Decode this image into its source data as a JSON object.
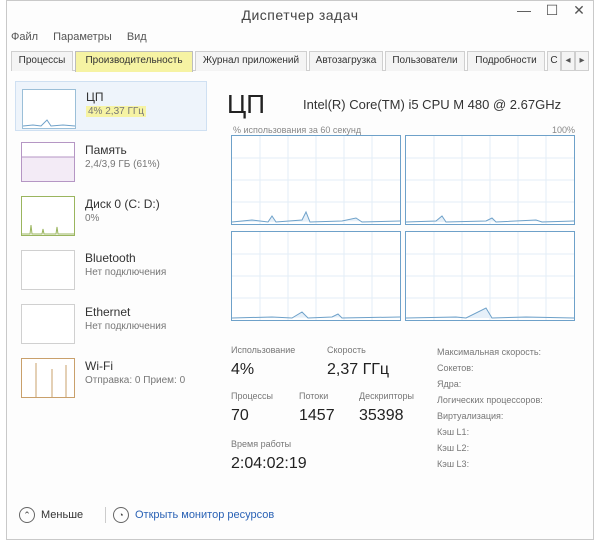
{
  "window": {
    "title": "Диспетчер задач",
    "min": "—",
    "max": "☐",
    "close": "✕"
  },
  "menu": [
    "Файл",
    "Параметры",
    "Вид"
  ],
  "tabs": [
    {
      "label": "Процессы",
      "active": false
    },
    {
      "label": "Производительность",
      "active": true
    },
    {
      "label": "Журнал приложений",
      "active": false
    },
    {
      "label": "Автозагрузка",
      "active": false
    },
    {
      "label": "Пользователи",
      "active": false
    },
    {
      "label": "Подробности",
      "active": false
    },
    {
      "label": "С",
      "active": false
    }
  ],
  "tab_nav": {
    "prev": "◂",
    "next": "▸"
  },
  "sidebar": [
    {
      "name": "ЦП",
      "sub": "4% 2,37 ГГц",
      "kind": "cpu"
    },
    {
      "name": "Память",
      "sub": "2,4/3,9 ГБ (61%)",
      "kind": "mem"
    },
    {
      "name": "Диск 0 (C: D:)",
      "sub": "0%",
      "kind": "disk"
    },
    {
      "name": "Bluetooth",
      "sub": "Нет подключения",
      "kind": "bt"
    },
    {
      "name": "Ethernet",
      "sub": "Нет подключения",
      "kind": "eth"
    },
    {
      "name": "Wi-Fi",
      "sub": "Отправка: 0 Прием: 0",
      "kind": "wifi"
    }
  ],
  "main": {
    "heading": "ЦП",
    "model": "Intel(R) Core(TM) i5 CPU M 480 @ 2.67GHz",
    "graph_label": "% использования за 60 секунд",
    "graph_max": "100%"
  },
  "stats": {
    "util_label": "Использование",
    "util_value": "4%",
    "speed_label": "Скорость",
    "speed_value": "2,37 ГГц",
    "proc_label": "Процессы",
    "proc_value": "70",
    "threads_label": "Потоки",
    "threads_value": "1457",
    "handles_label": "Дескрипторы",
    "handles_value": "35398",
    "uptime_label": "Время работы",
    "uptime_value": "2:04:02:19"
  },
  "properties": [
    "Максимальная скорость:",
    "Сокетов:",
    "Ядра:",
    "Логических процессоров:",
    "Виртуализация:",
    "Кэш L1:",
    "Кэш L2:",
    "Кэш L3:"
  ],
  "footer": {
    "less": "Меньше",
    "less_icon": "⌃",
    "link": "Открыть монитор ресурсов",
    "link_icon": "◔"
  }
}
